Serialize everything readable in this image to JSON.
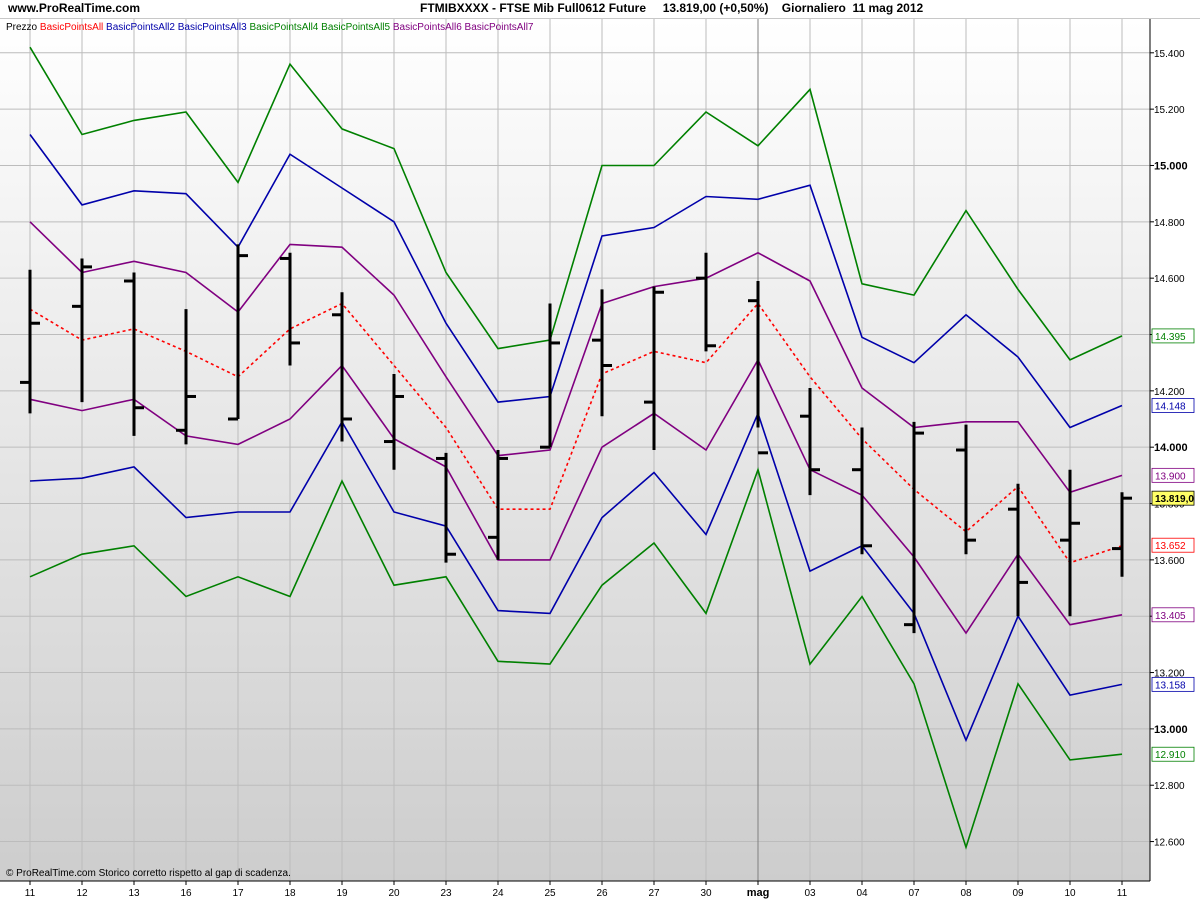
{
  "header": {
    "site": "www.ProRealTime.com",
    "instrument": "FTMIBXXXX - FTSE Mib Full0612 Future     13.819,00 (+0,50%)    Giornaliero  11 mag 2012"
  },
  "footer_note": "© ProRealTime.com  Storico corretto rispetto al gap di scadenza.",
  "colors": {
    "price": "#000000",
    "pivot": "#ff0000",
    "band1": "#800080",
    "band2": "#0000aa",
    "band3": "#008000",
    "bg_top": "#ffffff",
    "bg_bottom": "#cfcfcf",
    "last_price_bg": "#ffff66"
  },
  "chart_data": {
    "type": "ohlc",
    "legend": [
      {
        "label": "Prezzo",
        "color": "#000000"
      },
      {
        "label": "BasicPointsAll",
        "color": "#ff0000"
      },
      {
        "label": "BasicPointsAll2",
        "color": "#0000aa"
      },
      {
        "label": "BasicPointsAll3",
        "color": "#0000aa"
      },
      {
        "label": "BasicPointsAll4",
        "color": "#008000"
      },
      {
        "label": "BasicPointsAll5",
        "color": "#008000"
      },
      {
        "label": "BasicPointsAll6",
        "color": "#800080"
      },
      {
        "label": "BasicPointsAll7",
        "color": "#800080"
      }
    ],
    "x_labels": [
      "11",
      "12",
      "13",
      "16",
      "17",
      "18",
      "19",
      "20",
      "23",
      "24",
      "25",
      "26",
      "27",
      "30",
      "mag",
      "03",
      "04",
      "07",
      "08",
      "09",
      "10",
      "11"
    ],
    "ylim": [
      12460,
      15520
    ],
    "y_ticks": [
      {
        "value": 12600,
        "label": "12.600",
        "bold": false
      },
      {
        "value": 12800,
        "label": "12.800",
        "bold": false
      },
      {
        "value": 13000,
        "label": "13.000",
        "bold": true
      },
      {
        "value": 13200,
        "label": "13.200",
        "bold": false
      },
      {
        "value": 13400,
        "label": "13.400",
        "bold": false
      },
      {
        "value": 13600,
        "label": "13.600",
        "bold": false
      },
      {
        "value": 13800,
        "label": "13.800",
        "bold": false
      },
      {
        "value": 14000,
        "label": "14.000",
        "bold": true
      },
      {
        "value": 14200,
        "label": "14.200",
        "bold": false
      },
      {
        "value": 14400,
        "label": "14.400",
        "bold": false
      },
      {
        "value": 14600,
        "label": "14.600",
        "bold": false
      },
      {
        "value": 14800,
        "label": "14.800",
        "bold": false
      },
      {
        "value": 15000,
        "label": "15.000",
        "bold": true
      },
      {
        "value": 15200,
        "label": "15.200",
        "bold": false
      },
      {
        "value": 15400,
        "label": "15.400",
        "bold": false
      }
    ],
    "ohlc": [
      {
        "x": "11",
        "open": 14230,
        "high": 14630,
        "low": 14120,
        "close": 14440
      },
      {
        "x": "12",
        "open": 14500,
        "high": 14670,
        "low": 14160,
        "close": 14640
      },
      {
        "x": "13",
        "open": 14590,
        "high": 14620,
        "low": 14040,
        "close": 14140
      },
      {
        "x": "16",
        "open": 14060,
        "high": 14490,
        "low": 14010,
        "close": 14180
      },
      {
        "x": "17",
        "open": 14100,
        "high": 14720,
        "low": 14100,
        "close": 14680
      },
      {
        "x": "18",
        "open": 14670,
        "high": 14690,
        "low": 14290,
        "close": 14370
      },
      {
        "x": "19",
        "open": 14470,
        "high": 14550,
        "low": 14020,
        "close": 14100
      },
      {
        "x": "20",
        "open": 14020,
        "high": 14260,
        "low": 13920,
        "close": 14180
      },
      {
        "x": "23",
        "open": 13960,
        "high": 13980,
        "low": 13590,
        "close": 13620
      },
      {
        "x": "24",
        "open": 13680,
        "high": 13990,
        "low": 13600,
        "close": 13960
      },
      {
        "x": "25",
        "open": 14000,
        "high": 14510,
        "low": 14000,
        "close": 14370
      },
      {
        "x": "26",
        "open": 14380,
        "high": 14560,
        "low": 14110,
        "close": 14290
      },
      {
        "x": "27",
        "open": 14160,
        "high": 14570,
        "low": 13990,
        "close": 14550
      },
      {
        "x": "30",
        "open": 14600,
        "high": 14690,
        "low": 14340,
        "close": 14360
      },
      {
        "x": "mag",
        "open": 14520,
        "high": 14590,
        "low": 14070,
        "close": 13980
      },
      {
        "x": "03",
        "open": 14110,
        "high": 14210,
        "low": 13830,
        "close": 13920
      },
      {
        "x": "04",
        "open": 13920,
        "high": 14070,
        "low": 13620,
        "close": 13650
      },
      {
        "x": "07",
        "open": 13370,
        "high": 14090,
        "low": 13340,
        "close": 14050
      },
      {
        "x": "08",
        "open": 13990,
        "high": 14080,
        "low": 13620,
        "close": 13670
      },
      {
        "x": "09",
        "open": 13780,
        "high": 13870,
        "low": 13400,
        "close": 13520
      },
      {
        "x": "10",
        "open": 13670,
        "high": 13920,
        "low": 13400,
        "close": 13730
      },
      {
        "x": "11",
        "open": 13640,
        "high": 13840,
        "low": 13540,
        "close": 13819
      }
    ],
    "series": [
      {
        "name": "BasicPointsAll",
        "color": "#ff0000",
        "dashed": true,
        "values": [
          14490,
          14380,
          14420,
          14340,
          14250,
          14420,
          14510,
          14290,
          14070,
          13780,
          13780,
          14260,
          14340,
          14300,
          14510,
          14250,
          14030,
          13850,
          13700,
          13860,
          13590,
          13650
        ]
      },
      {
        "name": "BasicPointsAll6",
        "color": "#800080",
        "dashed": false,
        "values": [
          14800,
          14620,
          14660,
          14620,
          14480,
          14720,
          14710,
          14540,
          14250,
          13970,
          13990,
          14510,
          14570,
          14600,
          14690,
          14590,
          14210,
          14070,
          14090,
          14090,
          13840,
          13900
        ]
      },
      {
        "name": "BasicPointsAll7",
        "color": "#800080",
        "dashed": false,
        "values": [
          14170,
          14130,
          14170,
          14040,
          14010,
          14100,
          14290,
          14030,
          13930,
          13600,
          13600,
          14000,
          14120,
          13990,
          14310,
          13920,
          13830,
          13610,
          13340,
          13620,
          13370,
          13405
        ]
      },
      {
        "name": "BasicPointsAll2",
        "color": "#0000aa",
        "dashed": false,
        "values": [
          15110,
          14860,
          14910,
          14900,
          14710,
          15040,
          14920,
          14800,
          14440,
          14160,
          14180,
          14750,
          14780,
          14890,
          14880,
          14930,
          14390,
          14300,
          14470,
          14320,
          14070,
          14148
        ]
      },
      {
        "name": "BasicPointsAll3",
        "color": "#0000aa",
        "dashed": false,
        "values": [
          13880,
          13890,
          13930,
          13750,
          13770,
          13770,
          14090,
          13770,
          13720,
          13420,
          13410,
          13750,
          13910,
          13690,
          14120,
          13560,
          13650,
          13410,
          12960,
          13400,
          13120,
          13158
        ]
      },
      {
        "name": "BasicPointsAll4",
        "color": "#008000",
        "dashed": false,
        "values": [
          15420,
          15110,
          15160,
          15190,
          14940,
          15360,
          15130,
          15060,
          14620,
          14350,
          14380,
          15000,
          15000,
          15190,
          15070,
          15270,
          14580,
          14540,
          14840,
          14560,
          14310,
          14395
        ]
      },
      {
        "name": "BasicPointsAll5",
        "color": "#008000",
        "dashed": false,
        "values": [
          13540,
          13620,
          13650,
          13470,
          13540,
          13470,
          13880,
          13510,
          13540,
          13240,
          13230,
          13510,
          13660,
          13410,
          13920,
          13230,
          13470,
          13160,
          12580,
          13160,
          12890,
          12910
        ]
      }
    ],
    "last_values": [
      {
        "label": "14.395",
        "value": 14395,
        "color": "#008000"
      },
      {
        "label": "14.148",
        "value": 14148,
        "color": "#0000aa"
      },
      {
        "label": "13.900",
        "value": 13900,
        "color": "#800080"
      },
      {
        "label": "13.819,0",
        "value": 13819,
        "color": "#000000",
        "highlight": true
      },
      {
        "label": "13.652",
        "value": 13652,
        "color": "#ff0000"
      },
      {
        "label": "13.405",
        "value": 13405,
        "color": "#800080"
      },
      {
        "label": "13.158",
        "value": 13158,
        "color": "#0000aa"
      },
      {
        "label": "12.910",
        "value": 12910,
        "color": "#008000"
      }
    ],
    "vertical_marker": "mag",
    "grid": true,
    "legend_position": "top-left"
  }
}
